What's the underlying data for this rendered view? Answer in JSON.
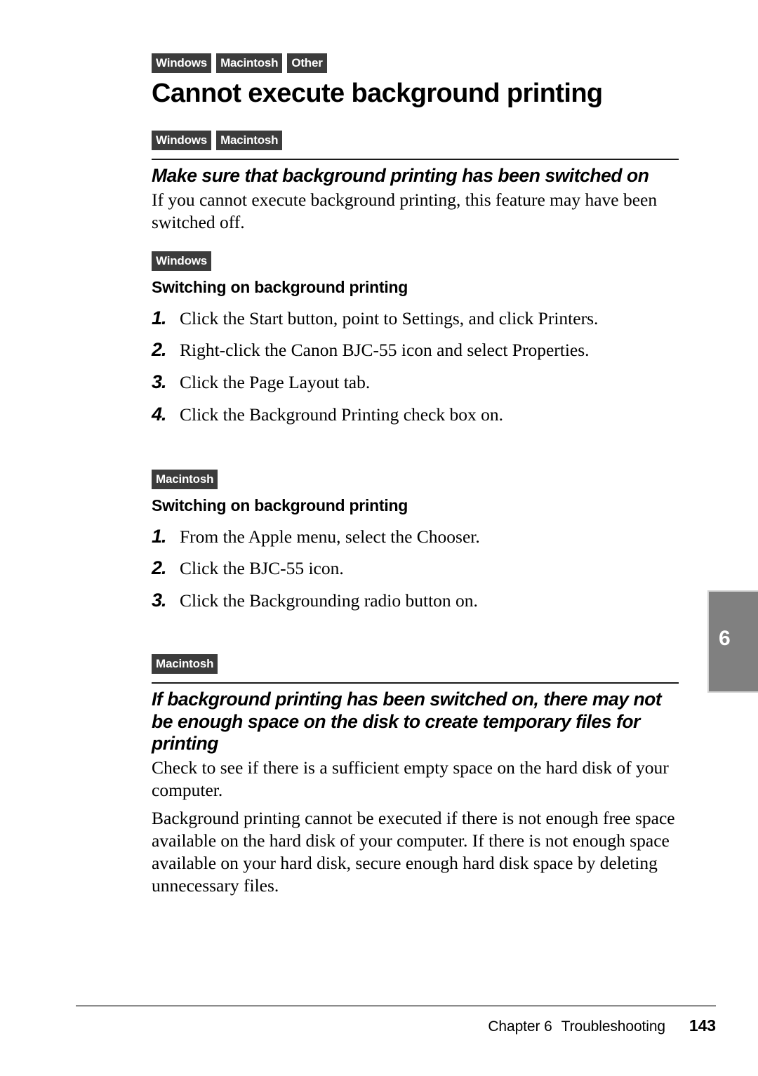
{
  "title_block": {
    "badges": [
      "Windows",
      "Macintosh",
      "Other"
    ],
    "title": "Cannot execute background printing"
  },
  "section_switched_on": {
    "badges": [
      "Windows",
      "Macintosh"
    ],
    "heading": "Make sure that background printing has been switched on",
    "body": "If you cannot execute background printing, this feature may have been switched off."
  },
  "windows_procedure": {
    "badges": [
      "Windows"
    ],
    "subheading": "Switching on background printing",
    "steps": [
      {
        "num": "1.",
        "text": "Click the Start button, point to Settings, and click Printers."
      },
      {
        "num": "2.",
        "text": "Right-click the Canon BJC-55 icon and select Properties."
      },
      {
        "num": "3.",
        "text": "Click the Page Layout tab."
      },
      {
        "num": "4.",
        "text": "Click the Background Printing check box on."
      }
    ]
  },
  "macintosh_procedure": {
    "badges": [
      "Macintosh"
    ],
    "subheading": "Switching on background printing",
    "steps": [
      {
        "num": "1.",
        "text": "From the Apple menu, select the Chooser."
      },
      {
        "num": "2.",
        "text": "Click the BJC-55 icon."
      },
      {
        "num": "3.",
        "text": "Click the Backgrounding radio button on."
      }
    ]
  },
  "section_disk_space": {
    "badges": [
      "Macintosh"
    ],
    "heading": "If background printing has been switched on, there may not be enough space on the disk to create temporary files for printing",
    "body": "Check to see if there is a sufficient empty space on the hard disk of your computer."
  },
  "closing_paragraph": {
    "body": "Background printing cannot be executed if there is not enough free space available on the hard disk of your computer. If there is not enough space available on your hard disk, secure enough hard disk space by deleting unnecessary files."
  },
  "chapter_tab": {
    "number": "6"
  },
  "footer": {
    "chapter": "Chapter 6",
    "section": "Troubleshooting",
    "page": "143"
  },
  "colors": {
    "badge_background": "#3c3c3c",
    "badge_text": "#ffffff",
    "tab_background": "#808080",
    "tab_text": "#ffffff",
    "rule": "#1a1a1a",
    "footer_rule": "#8c8c8c",
    "text": "#000000"
  }
}
